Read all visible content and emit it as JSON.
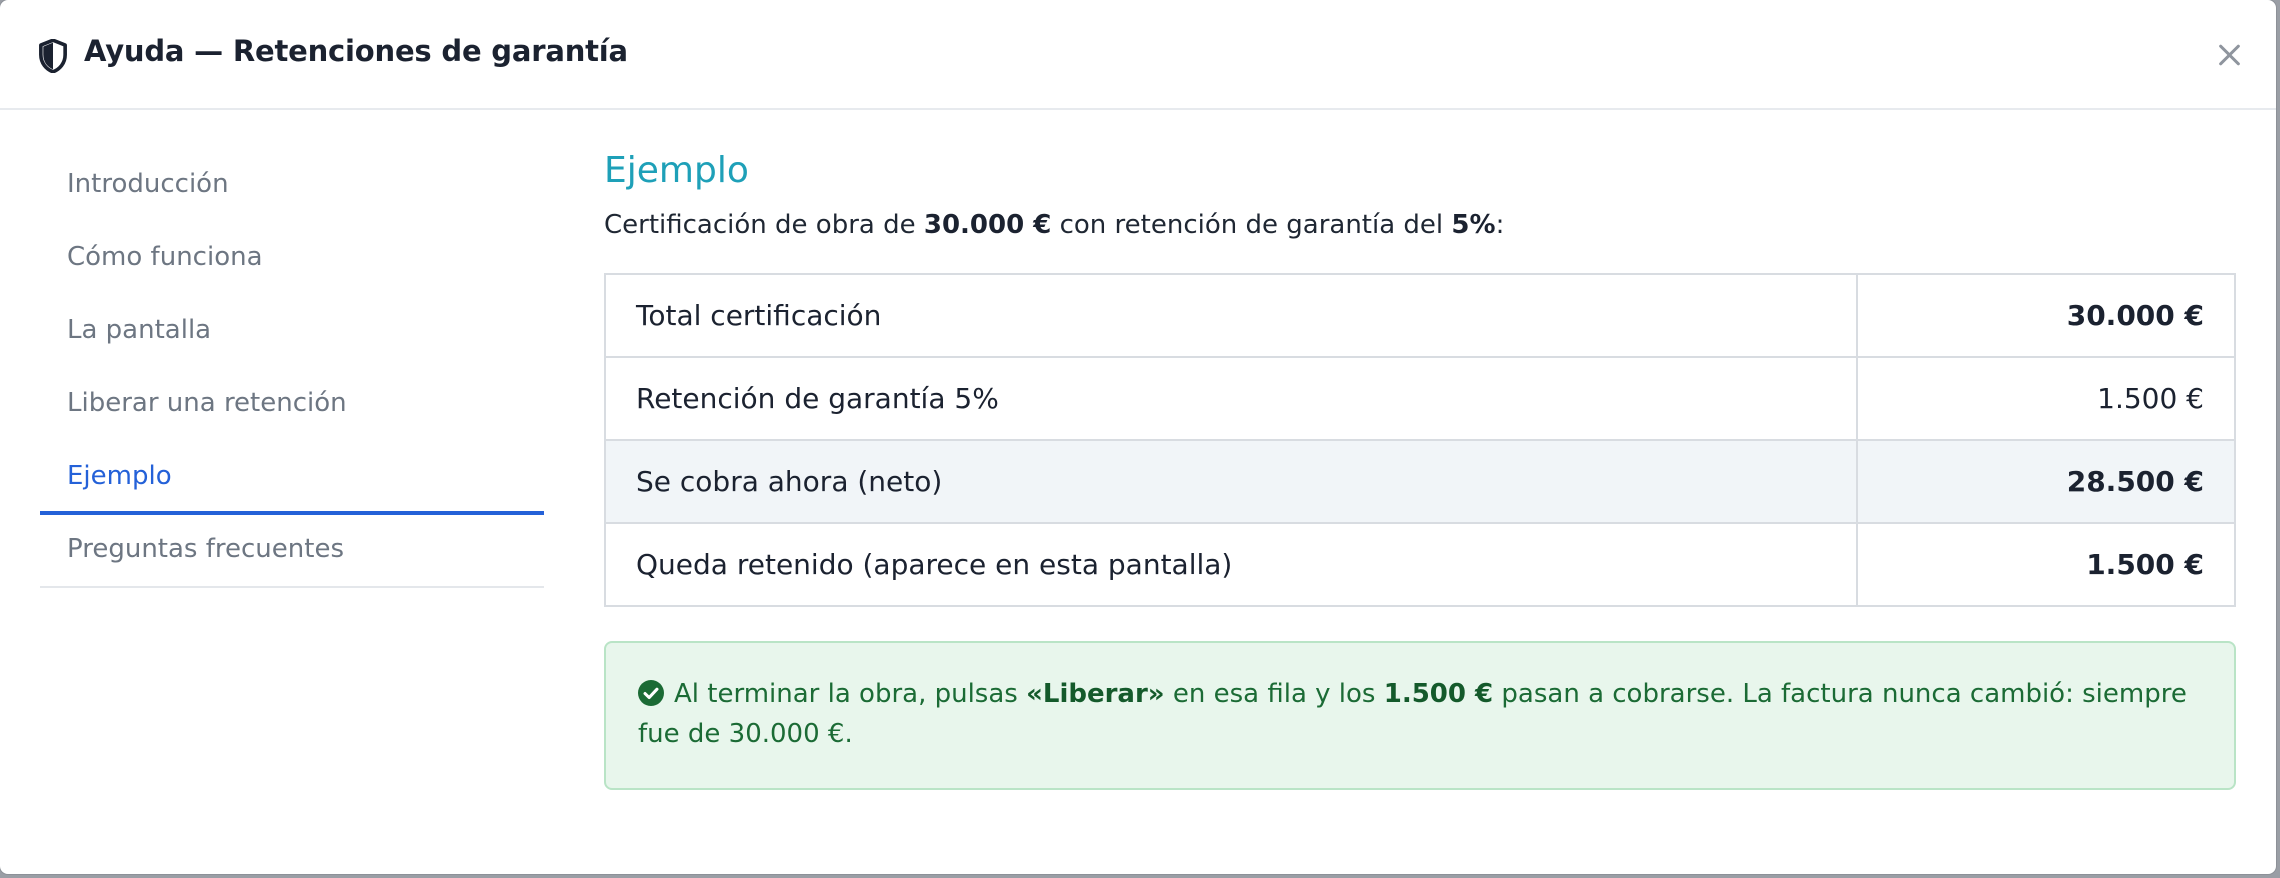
{
  "modal": {
    "title": "Ayuda — Retenciones de garantía",
    "header_icon": "shield-icon",
    "close_icon": "close-icon"
  },
  "sidebar": {
    "items": [
      {
        "label": "Introducción",
        "active": false
      },
      {
        "label": "Cómo funciona",
        "active": false
      },
      {
        "label": "La pantalla",
        "active": false
      },
      {
        "label": "Liberar una retención",
        "active": false
      },
      {
        "label": "Ejemplo",
        "active": true
      },
      {
        "label": "Preguntas frecuentes",
        "active": false
      }
    ]
  },
  "content": {
    "title": "Ejemplo",
    "intro": {
      "part1": "Certificación de obra de ",
      "amount": "30.000 €",
      "part2": " con retención de garantía del ",
      "percent": "5%",
      "part3": ":"
    },
    "table": {
      "rows": [
        {
          "label": "Total certificación",
          "value": "30.000 €",
          "bold": true,
          "highlight": false
        },
        {
          "label": "Retención de garantía 5%",
          "value": "1.500 €",
          "bold": false,
          "highlight": false
        },
        {
          "label": "Se cobra ahora (neto)",
          "value": "28.500 €",
          "bold": true,
          "highlight": true
        },
        {
          "label": "Queda retenido (aparece en esta pantalla)",
          "value": "1.500 €",
          "bold": true,
          "highlight": false
        }
      ]
    },
    "note": {
      "icon": "check-circle-icon",
      "part1": "Al terminar la obra, pulsas ",
      "action": "«Liberar»",
      "part2": " en esa fila y los ",
      "amount": "1.500 €",
      "part3": " pasan a cobrarse. La factura nunca cambió: siempre fue de 30.000 €."
    }
  },
  "colors": {
    "accent": "#2461d8",
    "title_teal": "#1ea0b8",
    "success_bg": "#e8f6ec",
    "success_text": "#1b6b35"
  }
}
